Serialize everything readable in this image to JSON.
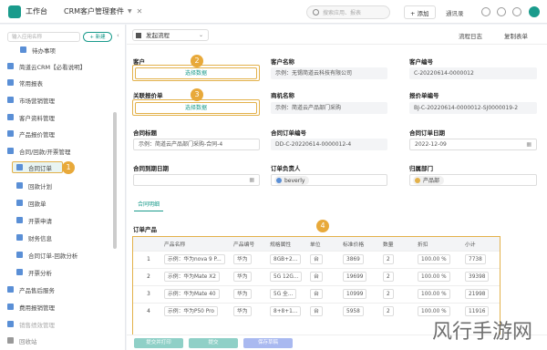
{
  "topbar": {
    "app_title": "工作台",
    "tab_title": "CRM客户管理套件",
    "search_placeholder": "搜索应用、报表",
    "add_label": "+ 添加",
    "notify_label": "通讯录"
  },
  "sidebar": {
    "search_placeholder": "输入应用名称",
    "new_label": "+ 新建",
    "items": [
      {
        "label": "待办事项"
      },
      {
        "label": "简道云CRM【必看说明】"
      },
      {
        "label": "常用报表"
      },
      {
        "label": "市场营销管理"
      },
      {
        "label": "客户资料管理"
      },
      {
        "label": "产品报价管理"
      },
      {
        "label": "合同/回款/开票管理"
      },
      {
        "label": "合同订单"
      },
      {
        "label": "回款计划"
      },
      {
        "label": "回款单"
      },
      {
        "label": "开票申请"
      },
      {
        "label": "财务信息"
      },
      {
        "label": "合同订单-回款分析"
      },
      {
        "label": "开票分析"
      },
      {
        "label": "产品售后服务"
      },
      {
        "label": "费用报销管理"
      },
      {
        "label": "销售绩效管理"
      },
      {
        "label": "回收站"
      }
    ],
    "badge_1": "1"
  },
  "toolbar": {
    "flow_label": "发起流程",
    "flow_log": "流程日志",
    "copy_form": "复制表单"
  },
  "form": {
    "customer_label": "客户",
    "customer_btn": "选择数据",
    "quote_label": "关联报价单",
    "quote_btn": "选择数据",
    "cust_name_label": "客户名称",
    "cust_name_value": "示例：无锡简道云科技有限公司",
    "cust_no_label": "客户编号",
    "cust_no_value": "C-20220614-0000012",
    "opp_name_label": "商机名称",
    "opp_name_value": "示例：简道云产品部门采购",
    "quote_no_label": "报价单编号",
    "quote_no_value": "BJ-C-20220614-0000012-SJ0000019-2",
    "contract_title_label": "合同标题",
    "contract_title_value": "示例：简道云产品部门采购-合同-4",
    "contract_no_label": "合同订单编号",
    "contract_no_value": "DD-C-20220614-0000012-4",
    "sign_date_label": "合同订单日期",
    "sign_date_value": "2022-12-09",
    "expire_label": "合同到期日期",
    "owner_label": "订单负责人",
    "owner_value": "beverly",
    "dept_label": "归属部门",
    "dept_value": "产品部",
    "badge_2": "2",
    "badge_3": "3",
    "badge_4": "4"
  },
  "tab": {
    "label": "合同明细"
  },
  "order_products": {
    "title": "订单产品",
    "columns": [
      "",
      "产品名称",
      "产品编号",
      "规格属性",
      "单位",
      "标准价格",
      "数量",
      "折扣",
      "小计"
    ],
    "rows": [
      {
        "idx": "1",
        "name": "示例：华为nova 9 P...",
        "code": "华为",
        "spec": "8GB+2...",
        "unit": "台",
        "price": "3869",
        "qty": "2",
        "discount": "100.00 %",
        "subtotal": "7738"
      },
      {
        "idx": "2",
        "name": "示例：华为Mate X2",
        "code": "华为",
        "spec": "5G 12G...",
        "unit": "台",
        "price": "19699",
        "qty": "2",
        "discount": "100.00 %",
        "subtotal": "39398"
      },
      {
        "idx": "3",
        "name": "示例：华为Mate 40",
        "code": "华为",
        "spec": "5G 全...",
        "unit": "台",
        "price": "10999",
        "qty": "2",
        "discount": "100.00 %",
        "subtotal": "21998"
      },
      {
        "idx": "4",
        "name": "示例：华为P50 Pro",
        "code": "华为",
        "spec": "8+8+1...",
        "unit": "台",
        "price": "5958",
        "qty": "2",
        "discount": "100.00 %",
        "subtotal": "11916"
      }
    ]
  },
  "footer": {
    "btn_submit_print": "提交并打印",
    "btn_submit": "提交",
    "btn_save_draft": "保存草稿"
  },
  "watermark": "风行手游网",
  "colors": {
    "accent": "#1a9b8c",
    "highlight": "#e3b14a",
    "badge": "#e8a93a"
  }
}
